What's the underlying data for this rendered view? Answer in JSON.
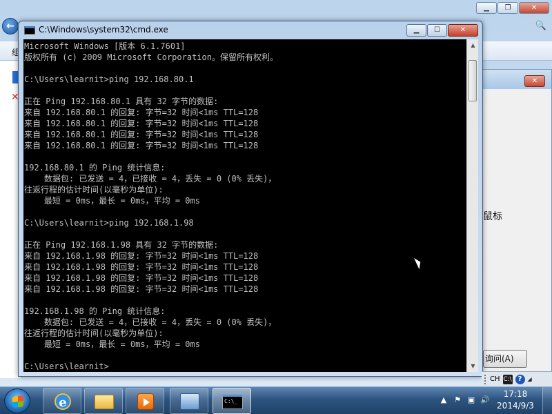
{
  "background_window": {
    "toolbar_text": "组",
    "dialog_text": "鼠标",
    "dialog_button": "询问(A)"
  },
  "cmd": {
    "title": "C:\\Windows\\system32\\cmd.exe",
    "lines": [
      "Microsoft Windows [版本 6.1.7601]",
      "版权所有 (c) 2009 Microsoft Corporation。保留所有权利。",
      "",
      "C:\\Users\\learnit>ping 192.168.80.1",
      "",
      "正在 Ping 192.168.80.1 具有 32 字节的数据:",
      "来自 192.168.80.1 的回复: 字节=32 时间<1ms TTL=128",
      "来自 192.168.80.1 的回复: 字节=32 时间<1ms TTL=128",
      "来自 192.168.80.1 的回复: 字节=32 时间<1ms TTL=128",
      "来自 192.168.80.1 的回复: 字节=32 时间<1ms TTL=128",
      "",
      "192.168.80.1 的 Ping 统计信息:",
      "    数据包: 已发送 = 4，已接收 = 4，丢失 = 0 (0% 丢失)，",
      "往返行程的估计时间(以毫秒为单位):",
      "    最短 = 0ms，最长 = 0ms，平均 = 0ms",
      "",
      "C:\\Users\\learnit>ping 192.168.1.98",
      "",
      "正在 Ping 192.168.1.98 具有 32 字节的数据:",
      "来自 192.168.1.98 的回复: 字节=32 时间<1ms TTL=128",
      "来自 192.168.1.98 的回复: 字节=32 时间<1ms TTL=128",
      "来自 192.168.1.98 的回复: 字节=32 时间<1ms TTL=128",
      "来自 192.168.1.98 的回复: 字节=32 时间<1ms TTL=128",
      "",
      "192.168.1.98 的 Ping 统计信息:",
      "    数据包: 已发送 = 4，已接收 = 4，丢失 = 0 (0% 丢失)，",
      "往返行程的估计时间(以毫秒为单位):",
      "    最短 = 0ms，最长 = 0ms，平均 = 0ms",
      "",
      "C:\\Users\\learnit>"
    ]
  },
  "langbar": {
    "lang": "CH",
    "ime": "C:\\",
    "help": "?"
  },
  "taskbar": {
    "buttons": [
      "internet-explorer",
      "windows-explorer",
      "media-player",
      "network",
      "cmd"
    ],
    "clock_time": "17:18",
    "clock_date": "2014/9/3"
  }
}
